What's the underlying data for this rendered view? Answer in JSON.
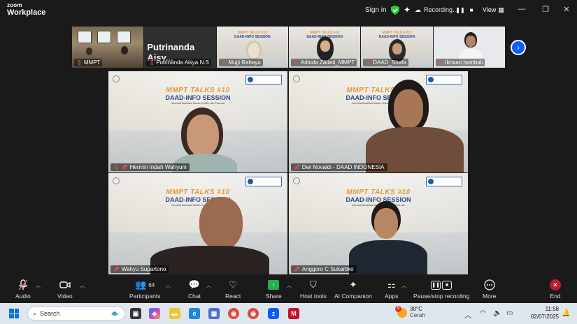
{
  "app": {
    "brand_line1": "zoom",
    "brand_line2": "Workplace"
  },
  "titlebar": {
    "sign_in": "Sign in",
    "recording": "Recording...",
    "view": "View"
  },
  "thumbnails": [
    {
      "name": "MMPT"
    },
    {
      "name": "Putrinanda Aisya N.S",
      "display_title": "Putrinanda  Aisy..."
    },
    {
      "name": "Mujji Rahayu"
    },
    {
      "name": "Adinda Zadati_MMPT"
    },
    {
      "name": "DAAD_Shafa"
    },
    {
      "name": "Ikhsan hambali"
    }
  ],
  "slide": {
    "title": "MMPT TALKS #10",
    "subtitle": "DAAD-INFO SESSION",
    "tagline": "Informasi Beasiswa Master, Doktor, dan Post-doc"
  },
  "gallery": [
    {
      "name": "Hermin Indah Wahyuni",
      "muted": true
    },
    {
      "name": "Dwi Novaldi - DAAD INDONESIA",
      "muted": false,
      "active": true
    },
    {
      "name": "Wahyu Supartono",
      "muted": false
    },
    {
      "name": "Anggoro C Sukartiko",
      "muted": false
    }
  ],
  "toolbar": {
    "audio": "Audio",
    "video": "Video",
    "participants": "Participants",
    "participants_count": "64",
    "chat": "Chat",
    "react": "React",
    "share": "Share",
    "host_tools": "Host tools",
    "ai_companion": "AI Companion",
    "apps": "Apps",
    "pause_recording": "Pause/stop recording",
    "more": "More",
    "end": "End"
  },
  "taskbar": {
    "search_placeholder": "Search",
    "weather_temp": "30°C",
    "weather_desc": "Cerah",
    "weather_badge": "5",
    "time": "11:58",
    "date": "02/07/2025"
  },
  "colors": {
    "accent_blue": "#0b5cff",
    "active_border": "#2ecc40",
    "end_red": "#b4212c",
    "share_green": "#22b14c"
  }
}
